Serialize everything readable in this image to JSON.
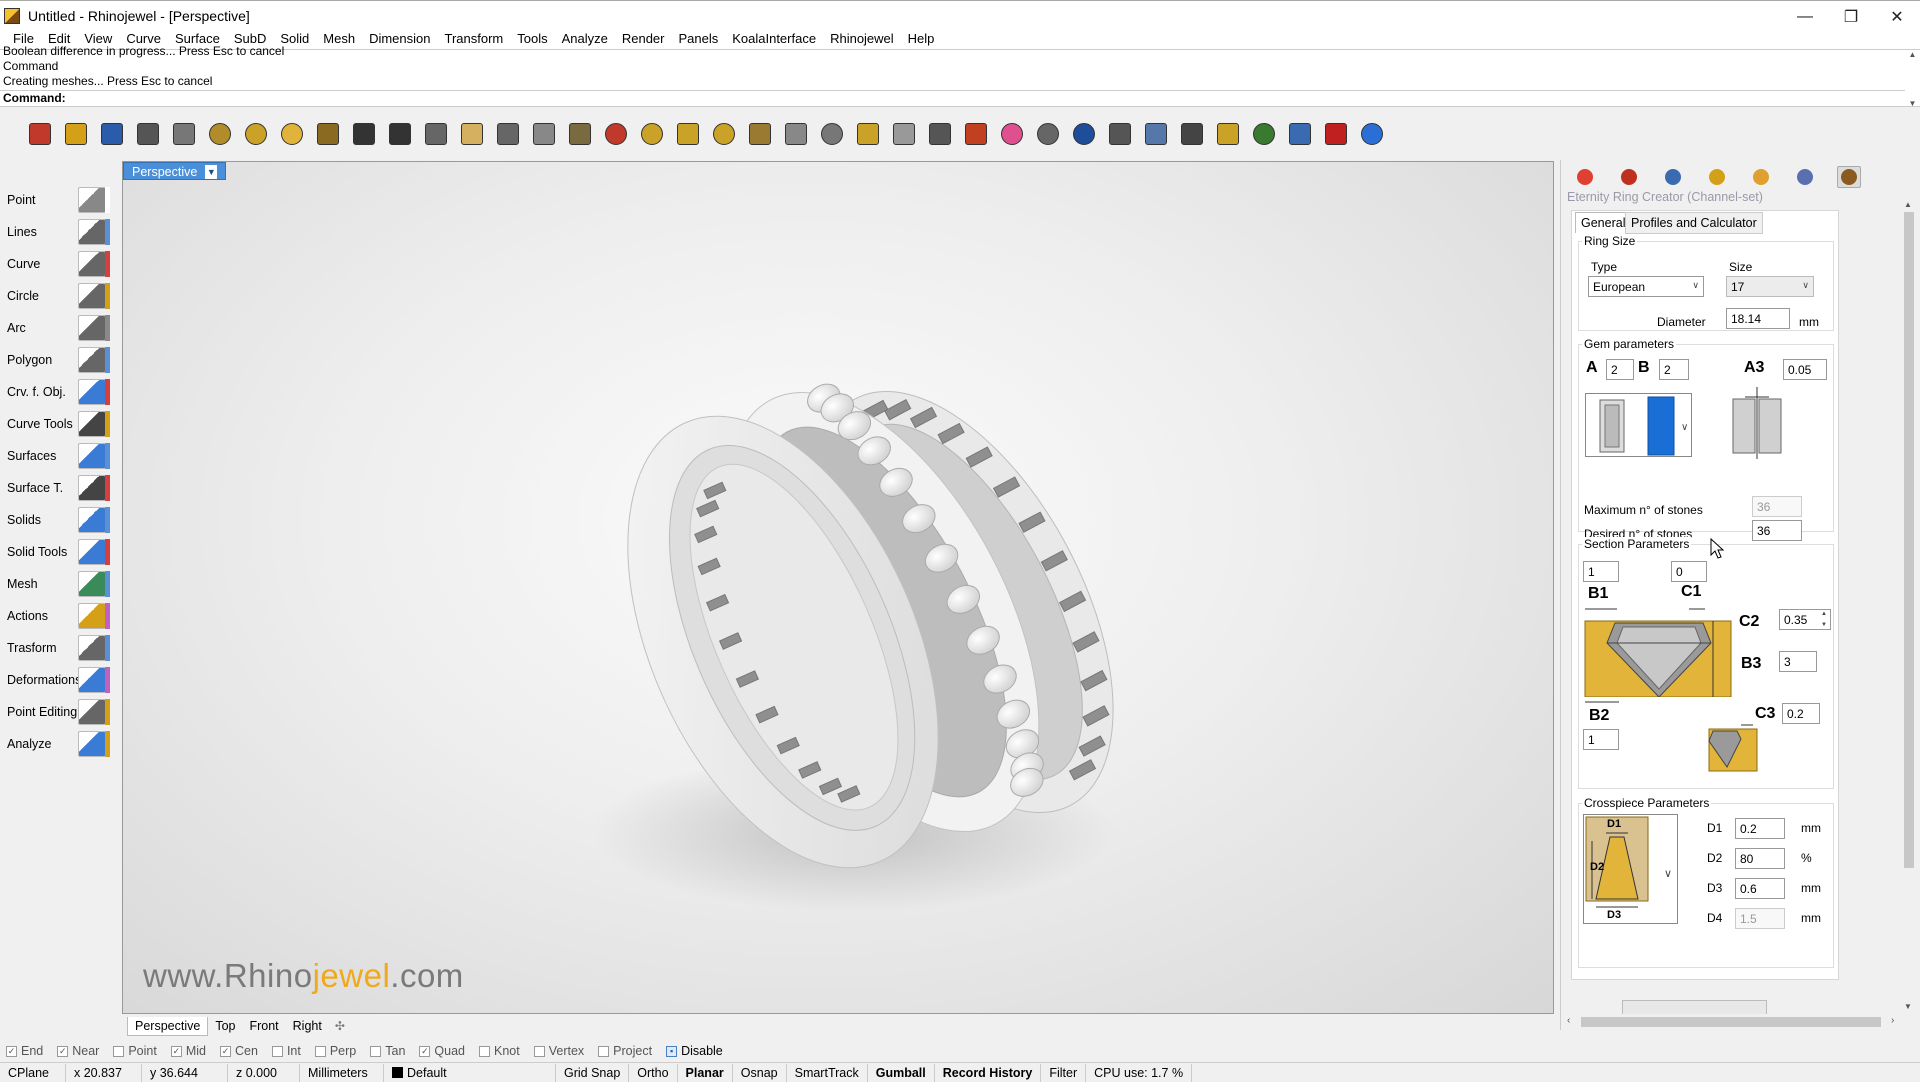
{
  "window": {
    "title": "Untitled - Rhinojewel - [Perspective]",
    "controls": [
      "—",
      "❐",
      "✕"
    ]
  },
  "menu": [
    "File",
    "Edit",
    "View",
    "Curve",
    "Surface",
    "SubD",
    "Solid",
    "Mesh",
    "Dimension",
    "Transform",
    "Tools",
    "Analyze",
    "Render",
    "Panels",
    "KoalaInterface",
    "Rhinojewel",
    "Help"
  ],
  "command": {
    "history": [
      "Boolean difference in progress... Press Esc to cancel",
      "Command",
      "Creating meshes... Press Esc to cancel"
    ],
    "prompt": "Command:"
  },
  "toolbar": {
    "icons": [
      "new-icon",
      "open-icon",
      "save-icon",
      "save-small-icon",
      "select-arrow-icon",
      "ring-tool-icon",
      "gem-gold-icon",
      "sphere-gold-icon",
      "lattice-icon",
      "undo-icon",
      "redo-icon",
      "copy-icon",
      "paste-icon",
      "zoom-extents-icon",
      "zoom-icon",
      "grid-view-icon",
      "gems-icon",
      "ring-outline-icon",
      "pendant-icon",
      "ring-gem-icon",
      "prongs-icon",
      "measure-icon",
      "dial-icon",
      "scale-icon",
      "light-icon",
      "lock-icon",
      "render-plate-icon",
      "color-wheel-icon",
      "material-ball-icon",
      "render-sphere-icon",
      "dimension-icon",
      "ruler-icon",
      "curve-icon",
      "gear-icon",
      "globe-icon",
      "cube-icon",
      "rhino7-icon",
      "help-icon"
    ],
    "colors": [
      "#c0392b",
      "#d4a017",
      "#2a5caa",
      "#555555",
      "#777777",
      "#b08d2a",
      "#c9a227",
      "#e0b43a",
      "#8a6a20",
      "#333333",
      "#333333",
      "#666666",
      "#d4b060",
      "#666666",
      "#888888",
      "#7a6a40",
      "#c0392b",
      "#c9a227",
      "#c9a227",
      "#c9a227",
      "#9a7a30",
      "#888888",
      "#777777",
      "#c9a227",
      "#999999",
      "#555555",
      "#c04020",
      "#e05090",
      "#666666",
      "#1e4d9a",
      "#555555",
      "#5577aa",
      "#444444",
      "#c9a227",
      "#3a7a30",
      "#3a6bb0",
      "#c02020",
      "#2a6fd6"
    ]
  },
  "sidebar": [
    {
      "label": "Point",
      "icon": "point-icon",
      "color": "#888888"
    },
    {
      "label": "Lines",
      "icon": "lines-icon",
      "color": "#666666"
    },
    {
      "label": "Curve",
      "icon": "curve-icon",
      "color": "#666666"
    },
    {
      "label": "Circle",
      "icon": "circle-icon",
      "color": "#666666"
    },
    {
      "label": "Arc",
      "icon": "arc-icon",
      "color": "#666666"
    },
    {
      "label": "Polygon",
      "icon": "polygon-icon",
      "color": "#666666"
    },
    {
      "label": "Crv. f. Obj.",
      "icon": "curve-from-object-icon",
      "color": "#3a7bd5"
    },
    {
      "label": "Curve Tools",
      "icon": "curve-tools-icon",
      "color": "#444444"
    },
    {
      "label": "Surfaces",
      "icon": "surfaces-icon",
      "color": "#3a7bd5"
    },
    {
      "label": "Surface T.",
      "icon": "surface-tools-icon",
      "color": "#444444"
    },
    {
      "label": "Solids",
      "icon": "solids-icon",
      "color": "#3a7bd5"
    },
    {
      "label": "Solid Tools",
      "icon": "solid-tools-icon",
      "color": "#3a7bd5"
    },
    {
      "label": "Mesh",
      "icon": "mesh-icon",
      "color": "#3a8a5a"
    },
    {
      "label": "Actions",
      "icon": "actions-icon",
      "color": "#d4a017"
    },
    {
      "label": "Trasform",
      "icon": "transform-icon",
      "color": "#666666"
    },
    {
      "label": "Deformations",
      "icon": "deformations-icon",
      "color": "#3a7bd5"
    },
    {
      "label": "Point Editing",
      "icon": "point-editing-icon",
      "color": "#666666"
    },
    {
      "label": "Analyze",
      "icon": "analyze-icon",
      "color": "#3a7bd5"
    }
  ],
  "sidebar_edge_colors": [
    "#ffffff",
    "#5b8fd6",
    "#d44040",
    "#d4a017",
    "#8a8a8a",
    "#5b8fd6",
    "#d44040",
    "#d4a017",
    "#5b8fd6",
    "#d44040",
    "#5b8fd6",
    "#d44040",
    "#5b8fd6",
    "#c060c0",
    "#5b8fd6",
    "#c060c0",
    "#d4a017",
    "#d4a017"
  ],
  "viewport": {
    "label": "Perspective",
    "watermark": {
      "part1": "www.Rhino",
      "part2": "jewel",
      "part3": ".com"
    }
  },
  "view_tabs": [
    "Perspective",
    "Top",
    "Front",
    "Right"
  ],
  "view_tab_add": "✣",
  "osnaps": [
    {
      "label": "End",
      "checked": true
    },
    {
      "label": "Near",
      "checked": true
    },
    {
      "label": "Point",
      "checked": false
    },
    {
      "label": "Mid",
      "checked": true
    },
    {
      "label": "Cen",
      "checked": true
    },
    {
      "label": "Int",
      "checked": false
    },
    {
      "label": "Perp",
      "checked": false
    },
    {
      "label": "Tan",
      "checked": false
    },
    {
      "label": "Quad",
      "checked": true
    },
    {
      "label": "Knot",
      "checked": false
    },
    {
      "label": "Vertex",
      "checked": false
    },
    {
      "label": "Project",
      "checked": false
    }
  ],
  "osnap_disable": "Disable",
  "status": {
    "cplane": "CPlane",
    "x": "x 20.837",
    "y": "y 36.644",
    "z": "z 0.000",
    "units": "Millimeters",
    "layer": "Default",
    "toggles": [
      {
        "label": "Grid Snap",
        "bold": false
      },
      {
        "label": "Ortho",
        "bold": false
      },
      {
        "label": "Planar",
        "bold": true
      },
      {
        "label": "Osnap",
        "bold": false
      },
      {
        "label": "SmartTrack",
        "bold": false
      },
      {
        "label": "Gumball",
        "bold": true
      },
      {
        "label": "Record History",
        "bold": true
      },
      {
        "label": "Filter",
        "bold": false
      }
    ],
    "cpu": "CPU use: 1.7 %"
  },
  "panel": {
    "tab_icons": [
      "materials-icon",
      "gems-shield-icon",
      "bracelet-icon",
      "pen-icon",
      "folder-icon",
      "display-icon",
      "ring-creator-icon"
    ],
    "tab_colors": [
      "#e04030",
      "#c03020",
      "#3a6bb0",
      "#d4a017",
      "#e0a030",
      "#5a6fb0",
      "#8a5a20"
    ],
    "title": "Eternity Ring Creator (Channel-set)",
    "tabs": [
      "General",
      "Profiles and Calculator"
    ],
    "ring_size": {
      "title": "Ring Size",
      "type_label": "Type",
      "type_value": "European",
      "size_label": "Size",
      "size_value": "17",
      "diameter_label": "Diameter",
      "diameter_value": "18.14",
      "unit": "mm"
    },
    "gem": {
      "title": "Gem parameters",
      "a_label": "A",
      "a_value": "2",
      "b_label": "B",
      "b_value": "2",
      "a3_label": "A3",
      "a3_value": "0.05",
      "max_label": "Maximum n° of stones",
      "max_value": "36",
      "desired_label": "Desired n° of stones",
      "desired_value": "36"
    },
    "section": {
      "title": "Section Parameters",
      "field1": "1",
      "field2": "0",
      "b1": "B1",
      "c1": "C1",
      "c2": "C2",
      "c2_value": "0.35",
      "b3": "B3",
      "b3_value": "3",
      "b2": "B2",
      "b2_value": "1",
      "c3": "C3",
      "c3_value": "0.2"
    },
    "crosspiece": {
      "title": "Crosspiece Parameters",
      "diagram_labels": [
        "D1",
        "D2",
        "D3"
      ],
      "rows": [
        {
          "label": "D1",
          "value": "0.2",
          "unit": "mm"
        },
        {
          "label": "D2",
          "value": "80",
          "unit": "%"
        },
        {
          "label": "D3",
          "value": "0.6",
          "unit": "mm"
        },
        {
          "label": "D4",
          "value": "1.5",
          "unit": "mm"
        }
      ]
    }
  }
}
